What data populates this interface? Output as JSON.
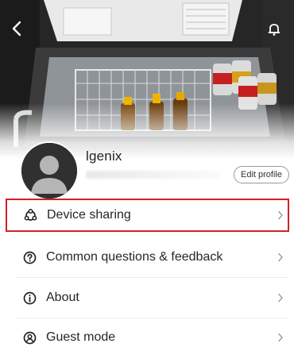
{
  "header": {
    "back_icon": "chevron-left-icon",
    "notification_icon": "bell-icon"
  },
  "profile": {
    "username": "lgenix",
    "edit_label": "Edit profile"
  },
  "menu": {
    "items": [
      {
        "label": "Device sharing",
        "icon": "device-sharing-icon",
        "highlighted": true
      },
      {
        "label": "Common questions & feedback",
        "icon": "question-icon",
        "highlighted": false
      },
      {
        "label": "About",
        "icon": "info-icon",
        "highlighted": false
      },
      {
        "label": "Guest mode",
        "icon": "guest-icon",
        "highlighted": false
      }
    ],
    "chevron_icon": "chevron-right-icon"
  },
  "colors": {
    "highlight_border": "#d0212c",
    "text": "#262626"
  }
}
